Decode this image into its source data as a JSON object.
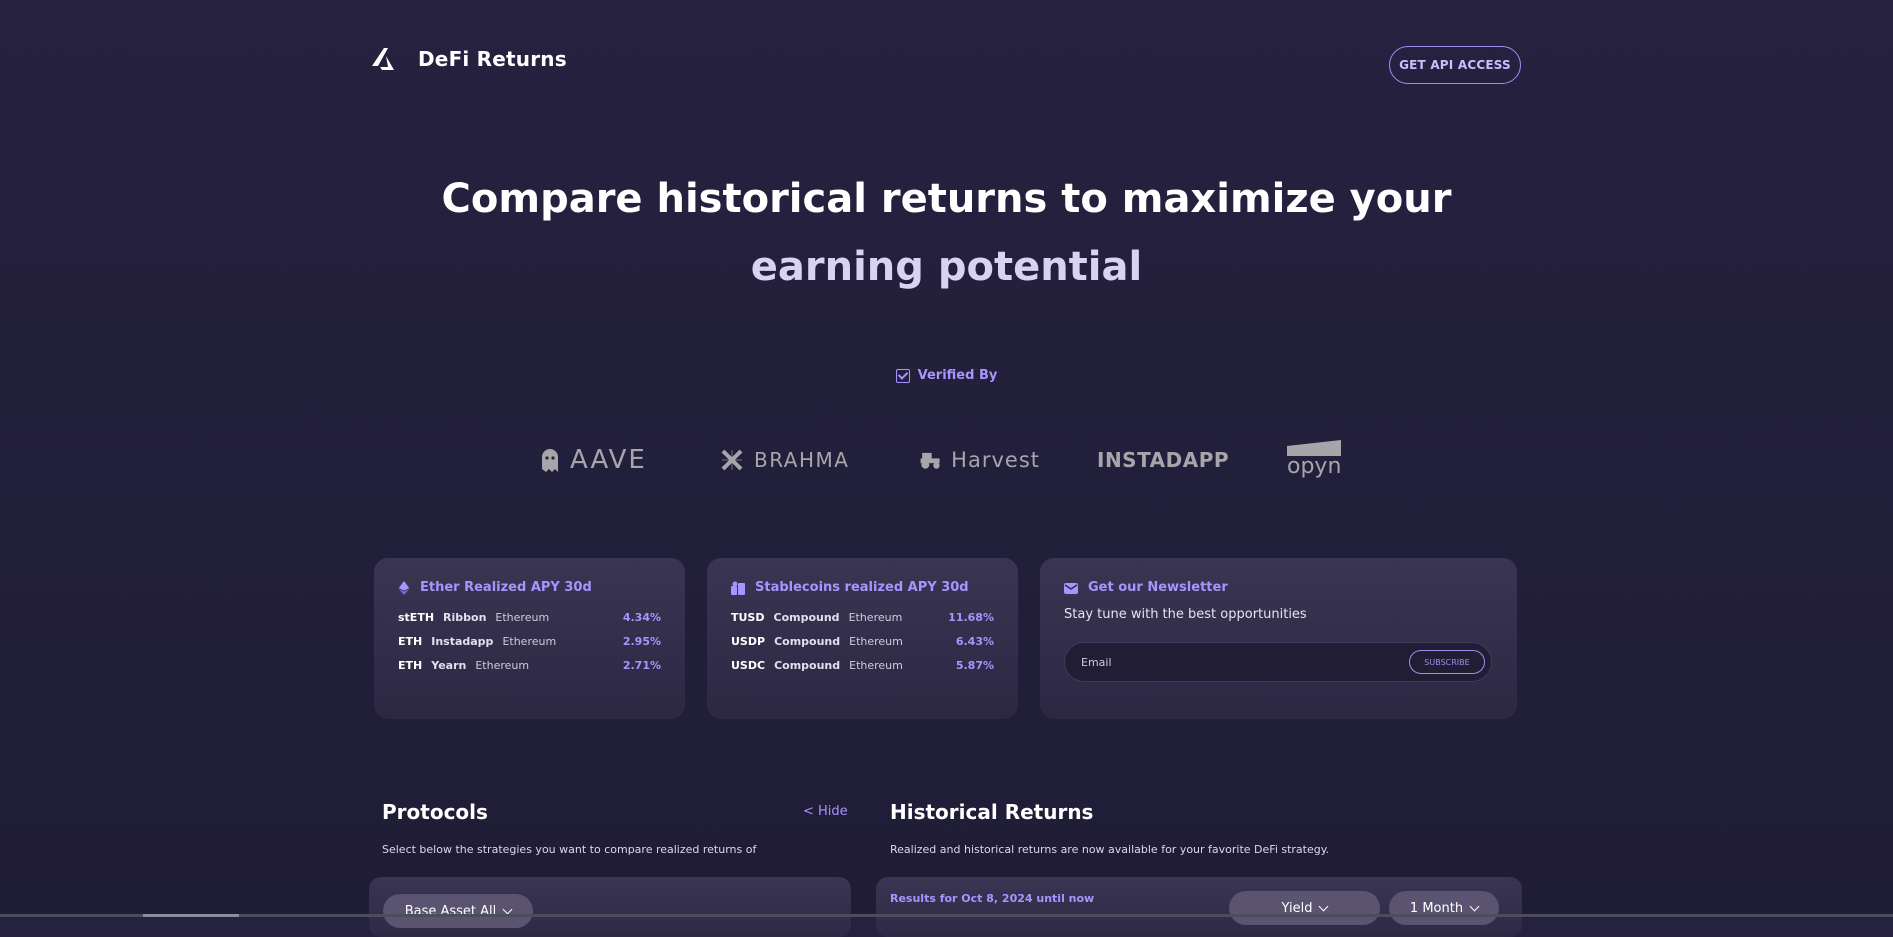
{
  "header": {
    "brand": "DeFi Returns",
    "api_button": "GET API ACCESS"
  },
  "hero": {
    "line1": "Compare historical returns to maximize your",
    "line2": "earning potential"
  },
  "verified": {
    "label": "Verified By",
    "partners": [
      "AAVE",
      "BRAHMA",
      "Harvest",
      "INSTADAPP",
      "opyn"
    ]
  },
  "ether_card": {
    "title": "Ether Realized APY 30d",
    "rows": [
      {
        "asset": "stETH",
        "protocol": "Ribbon",
        "chain": "Ethereum",
        "apy": "4.34%"
      },
      {
        "asset": "ETH",
        "protocol": "Instadapp",
        "chain": "Ethereum",
        "apy": "2.95%"
      },
      {
        "asset": "ETH",
        "protocol": "Yearn",
        "chain": "Ethereum",
        "apy": "2.71%"
      }
    ]
  },
  "stable_card": {
    "title": "Stablecoins realized APY 30d",
    "rows": [
      {
        "asset": "TUSD",
        "protocol": "Compound",
        "chain": "Ethereum",
        "apy": "11.68%"
      },
      {
        "asset": "USDP",
        "protocol": "Compound",
        "chain": "Ethereum",
        "apy": "6.43%"
      },
      {
        "asset": "USDC",
        "protocol": "Compound",
        "chain": "Ethereum",
        "apy": "5.87%"
      }
    ]
  },
  "newsletter": {
    "title": "Get our Newsletter",
    "subtitle": "Stay tune with the best opportunities",
    "email_placeholder": "Email",
    "subscribe": "SUBSCRIBE"
  },
  "protocols": {
    "title": "Protocols",
    "hide": "< Hide",
    "description": "Select below the strategies you want to compare realized returns of",
    "base_asset": "Base Asset All"
  },
  "historical": {
    "title": "Historical Returns",
    "description": "Realized and historical returns are now available for your favorite DeFi strategy.",
    "results": "Results for Oct 8, 2024 until now",
    "metric": "Yield",
    "period": "1 Month"
  },
  "colors": {
    "accent": "#a993ff",
    "background": "#25213e",
    "card": "#3a3552"
  }
}
